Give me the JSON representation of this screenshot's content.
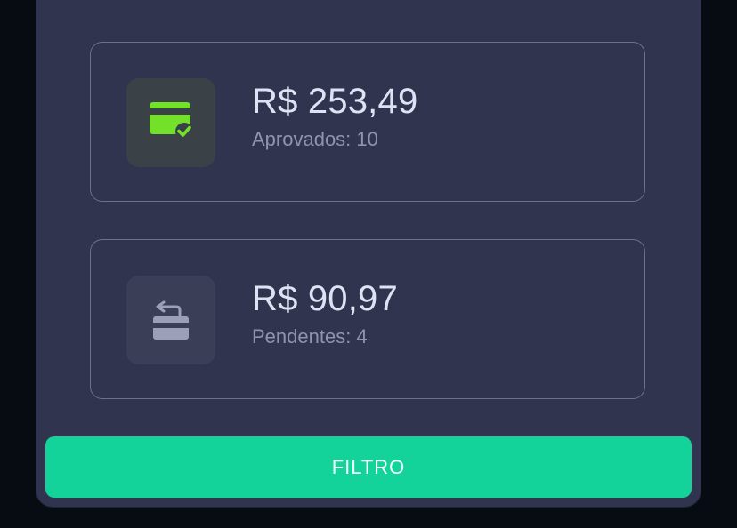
{
  "cards": [
    {
      "amount": "R$ 253,49",
      "subtitle": "Aprovados: 10",
      "icon": "credit-card-check-icon",
      "icon_color": "#73e12a"
    },
    {
      "amount": "R$ 90,97",
      "subtitle": "Pendentes: 4",
      "icon": "card-return-icon",
      "icon_color": "#9aa0b8"
    }
  ],
  "button": {
    "label": "FILTRO",
    "color": "#13d39a"
  },
  "colors": {
    "background": "#070b12",
    "panel": "#31344e",
    "amount_text": "#dfe2f4",
    "subtitle_text": "#8f93ab"
  }
}
